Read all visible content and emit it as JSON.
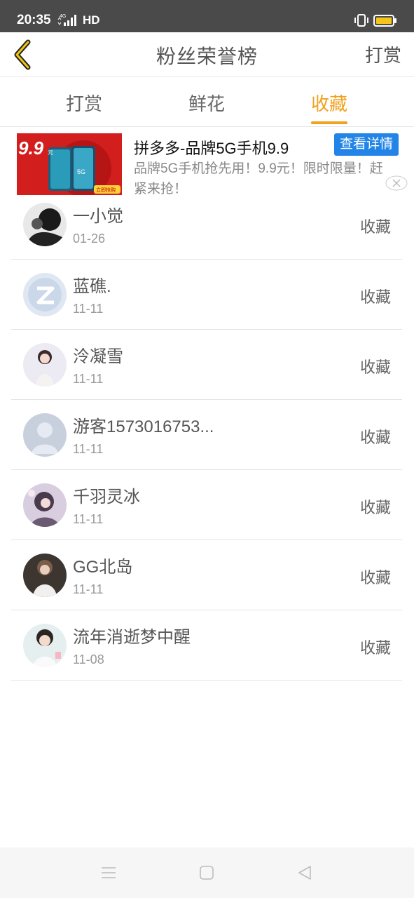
{
  "status_bar": {
    "time": "20:35",
    "network": "HD",
    "signal_icon": "signal-4g-icon",
    "vibrate_icon": "vibrate-icon",
    "battery_icon": "battery-icon"
  },
  "header": {
    "title": "粉丝荣誉榜",
    "right_action": "打赏",
    "back_icon": "chevron-left-icon"
  },
  "tabs": [
    {
      "label": "打赏",
      "active": false
    },
    {
      "label": "鲜花",
      "active": false
    },
    {
      "label": "收藏",
      "active": true
    }
  ],
  "ad": {
    "title": "拼多多-品牌5G手机9.9",
    "button": "查看详情",
    "description": "品牌5G手机抢先用！9.9元！限时限量！赶紧来抢！",
    "image_price": "9.9",
    "image_unit": "元",
    "image_badge": "5G",
    "image_cta": "立即抢购",
    "close_icon": "close-icon"
  },
  "list": {
    "items": [
      {
        "name": "一小觉",
        "date": "01-26",
        "action": "收藏"
      },
      {
        "name": "蓝礁.",
        "date": "11-11",
        "action": "收藏"
      },
      {
        "name": "泠凝雪",
        "date": "11-11",
        "action": "收藏"
      },
      {
        "name": "游客1573016753...",
        "date": "11-11",
        "action": "收藏"
      },
      {
        "name": "千羽灵冰",
        "date": "11-11",
        "action": "收藏"
      },
      {
        "name": "GG北岛",
        "date": "11-11",
        "action": "收藏"
      },
      {
        "name": "流年消逝梦中醒",
        "date": "11-08",
        "action": "收藏"
      }
    ]
  },
  "nav_bar": {
    "menu_icon": "menu-icon",
    "home_icon": "home-square-icon",
    "back_icon": "back-triangle-icon"
  },
  "colors": {
    "accent": "#f0a11d",
    "ad_button": "#2384e8",
    "status_bar": "#4a4a4a"
  }
}
